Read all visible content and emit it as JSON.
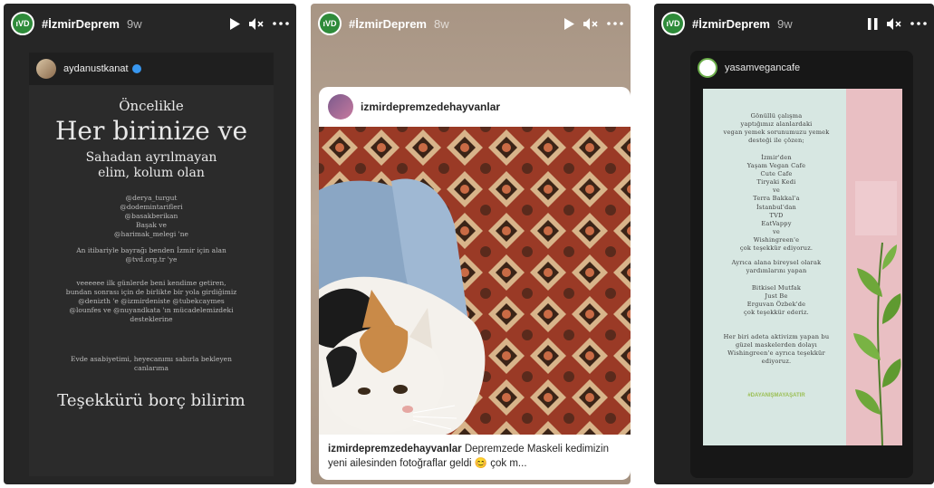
{
  "stories": [
    {
      "header": {
        "user": "#İzmirDeprem",
        "time": "9w",
        "avatar_text": "ıVD",
        "playback": "play"
      },
      "post": {
        "user": "aydanustkanat",
        "intro": "Öncelikle",
        "big": "Her birinize ve",
        "mid_lines": [
          "Sahadan ayrılmayan",
          "elim, kolum olan"
        ],
        "mentions": [
          "@derya_turgut",
          "@dodemintarifleri",
          "@basakberikan",
          "Başak ve",
          "@harimak_melegi 'ne"
        ],
        "para1": "An itibariyle bayrağı benden İzmir için alan @tvd.org.tr 'ye",
        "para2": "veeeeee ilk günlerde beni kendime getiren, bundan sonrası için de birlikte bir yola girdiğimiz @denizth 'e @izmirdeniste @tubekcaymes @lounfes ve @nuyandkata 'ın mücadelemizdeki desteklerine",
        "para3": "Evde asabiyetimi, heyecanımı sabırla bekleyen canlarıma",
        "footer": "Teşekkürü borç bilirim"
      }
    },
    {
      "header": {
        "user": "#İzmirDeprem",
        "time": "8w",
        "avatar_text": "ıVD",
        "playback": "play"
      },
      "post": {
        "user": "izmirdepremzedehayvanlar",
        "caption_user": "izmirdepremzedehayvanlar",
        "caption_text": "Depremzede Maskeli kedimizin  yeni ailesinden fotoğraflar geldi 😊 çok m..."
      }
    },
    {
      "header": {
        "user": "#İzmirDeprem",
        "time": "9w",
        "avatar_text": "ıVD",
        "playback": "pause"
      },
      "post": {
        "user": "yasamvegancafe",
        "block1": [
          "Gönüllü çalışma",
          "yaptığımız alanlardaki",
          "vegan yemek sorunumuzu yemek",
          "desteği ile çözen;"
        ],
        "block2": [
          "İzmir'den",
          "Yaşam Vegan Cafe",
          "Cute Cafe",
          "Tiryaki Kedi",
          "ve",
          "Terra Bakkal'a",
          "İstanbul'dan",
          "TVD",
          "EatVappy",
          "ve",
          "Wishingreen'e",
          "çok teşekkür ediyoruz."
        ],
        "block3": [
          "Ayrıca alana bireysel olarak",
          "yardımlarını yapan"
        ],
        "block4": [
          "Bitkisel Mutfak",
          "Just Be",
          "Erguvan Özbek'de",
          "çok teşekkür ederiz."
        ],
        "block5": [
          "Her biri adeta aktivizm yapan bu",
          "güzel maskelerden dolayı",
          "Wishingreen'e ayrıca teşekkür",
          "ediyoruz."
        ],
        "hashtag": "#DAYANIŞMAYAŞATIR"
      }
    }
  ],
  "colors": {
    "accent_green": "#2e8b3a",
    "verified_blue": "#3897f0",
    "poster_mint": "#d7e7e2",
    "poster_pink": "#e9bfc3"
  }
}
